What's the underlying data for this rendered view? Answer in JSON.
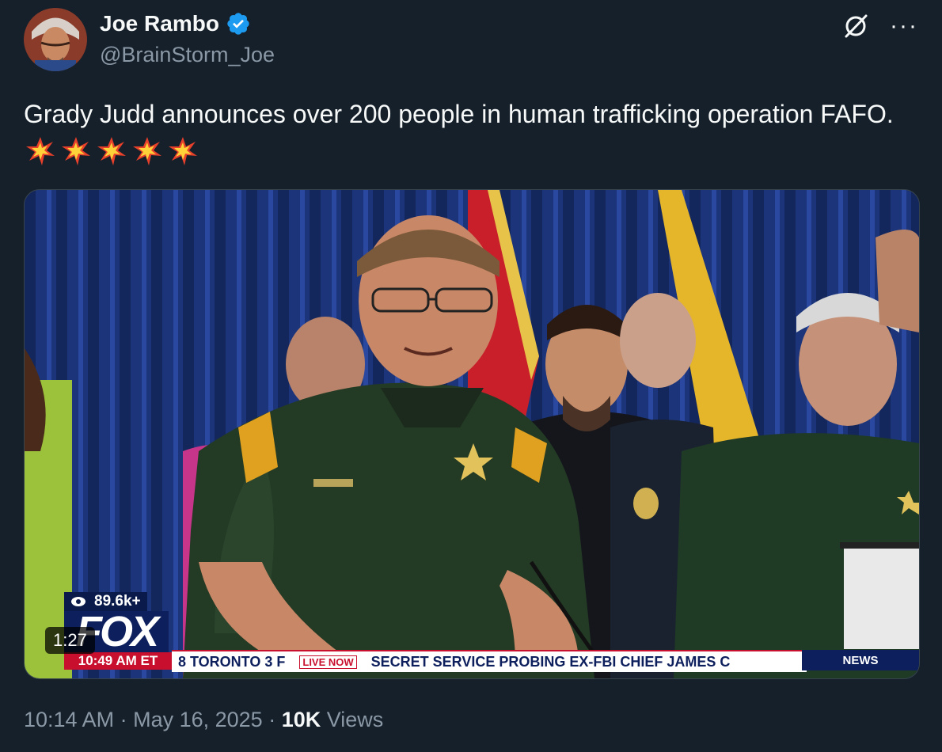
{
  "author": {
    "display_name": "Joe Rambo",
    "handle": "@BrainStorm_Joe",
    "verified": true,
    "avatar_icon": "avatar-illustration"
  },
  "header_icons": [
    "grok-icon",
    "more-icon"
  ],
  "more_label": "···",
  "tweet": {
    "text": "Grady Judd announces over 200 people in human trafficking operation FAFO.",
    "emoji": [
      "collision-icon",
      "collision-icon",
      "collision-icon",
      "collision-icon",
      "collision-icon"
    ]
  },
  "video": {
    "duration": "1:27",
    "overlay": {
      "views_badge": "89.6k+",
      "network_logo": "FOX",
      "clock": "10:49 AM ET",
      "ticker_weather": "8  TORONTO  3  F",
      "live_tag": "LIVE NOW",
      "ticker_headline": "SECRET SERVICE PROBING EX-FBI CHIEF JAMES C",
      "news_tag": "NEWS"
    }
  },
  "meta": {
    "time": "10:14 AM",
    "separator": " · ",
    "date": "May 16, 2025",
    "views_count": "10K",
    "views_label": " Views"
  },
  "colors": {
    "background": "#15202b",
    "verified_blue": "#1d9bf0",
    "secondary_text": "#8b98a5",
    "fox_red": "#c8102e",
    "fox_navy": "#0d1f5c"
  }
}
